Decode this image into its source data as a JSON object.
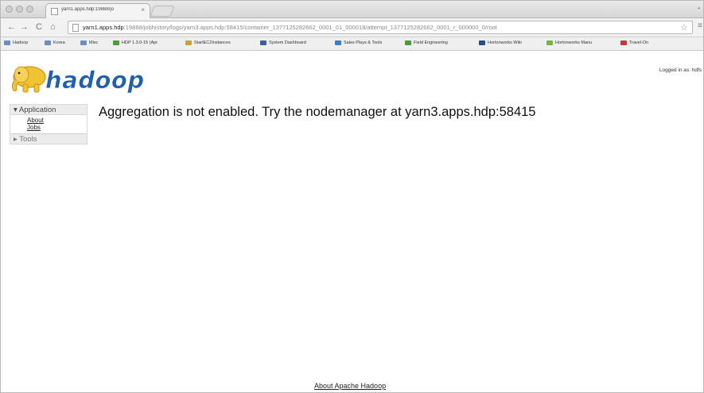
{
  "browser": {
    "tab": {
      "title": "yarn1.apps.hdp:19888/jo",
      "close": "×"
    },
    "toolbar": {
      "back": "←",
      "forward": "→",
      "reload": "C",
      "home": "⌂",
      "url_host": "yarn1.apps.hdp",
      "url_rest": ":19888/jobhistory/logs/yarn3.apps.hdp:58415/container_1377125282662_0001_01_000018/attempt_1377125282662_0001_r_000000_0/root",
      "star": "☆",
      "menu": "≡"
    },
    "bookmarks": [
      {
        "label": "Hadoop",
        "color": "#6c8fb8"
      },
      {
        "label": "Korea",
        "color": "#6c8fb8"
      },
      {
        "label": "Misc",
        "color": "#6c8fb8"
      },
      {
        "label": "HDP 1.3.0-15 (Apr",
        "color": "#4d9a3a"
      },
      {
        "label": "StartEC2Instances",
        "color": "#c9a232"
      },
      {
        "label": "System Dashboard",
        "color": "#3a5f9e"
      },
      {
        "label": "Sales Plays & Tools",
        "color": "#3f7fc9"
      },
      {
        "label": "Field Engineering",
        "color": "#4d9a3a"
      },
      {
        "label": "Hortonworks Wiki",
        "color": "#2b4a8a"
      },
      {
        "label": "Hortonworks Manu",
        "color": "#7ab342"
      },
      {
        "label": "Travel-On",
        "color": "#c23a3a"
      }
    ]
  },
  "page": {
    "logo_text": "hadoop",
    "logged_in": "Logged in as: hdfs",
    "nav": {
      "application_label": "Application",
      "application_toggle": "▾",
      "links": [
        "About",
        "Jobs"
      ],
      "tools_label": "Tools",
      "tools_toggle": "▸"
    },
    "message": "Aggregation is not enabled. Try the nodemanager at yarn3.apps.hdp:58415",
    "footer_link": "About Apache Hadoop"
  },
  "colors": {
    "logo_fill": "#1f5fb0",
    "logo_stroke": "#ffffff",
    "elephant": "#f1c232",
    "elephant_edge": "#c9931a"
  }
}
